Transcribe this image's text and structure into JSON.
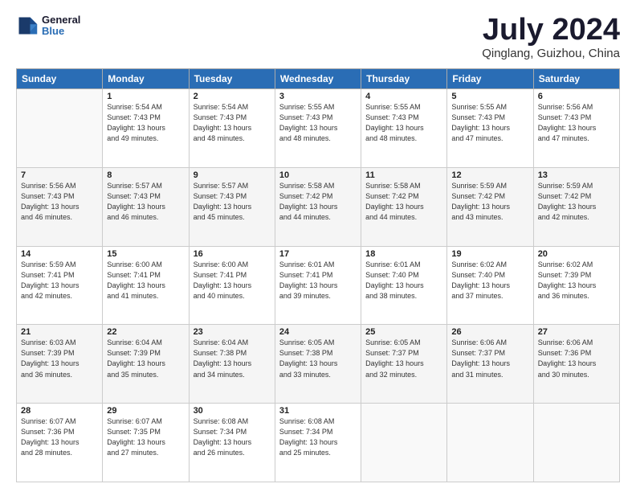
{
  "header": {
    "logo_line1": "General",
    "logo_line2": "Blue",
    "month_title": "July 2024",
    "location": "Qinglang, Guizhou, China"
  },
  "days_of_week": [
    "Sunday",
    "Monday",
    "Tuesday",
    "Wednesday",
    "Thursday",
    "Friday",
    "Saturday"
  ],
  "weeks": [
    [
      {
        "day": "",
        "content": ""
      },
      {
        "day": "1",
        "content": "Sunrise: 5:54 AM\nSunset: 7:43 PM\nDaylight: 13 hours\nand 49 minutes."
      },
      {
        "day": "2",
        "content": "Sunrise: 5:54 AM\nSunset: 7:43 PM\nDaylight: 13 hours\nand 48 minutes."
      },
      {
        "day": "3",
        "content": "Sunrise: 5:55 AM\nSunset: 7:43 PM\nDaylight: 13 hours\nand 48 minutes."
      },
      {
        "day": "4",
        "content": "Sunrise: 5:55 AM\nSunset: 7:43 PM\nDaylight: 13 hours\nand 48 minutes."
      },
      {
        "day": "5",
        "content": "Sunrise: 5:55 AM\nSunset: 7:43 PM\nDaylight: 13 hours\nand 47 minutes."
      },
      {
        "day": "6",
        "content": "Sunrise: 5:56 AM\nSunset: 7:43 PM\nDaylight: 13 hours\nand 47 minutes."
      }
    ],
    [
      {
        "day": "7",
        "content": "Sunrise: 5:56 AM\nSunset: 7:43 PM\nDaylight: 13 hours\nand 46 minutes."
      },
      {
        "day": "8",
        "content": "Sunrise: 5:57 AM\nSunset: 7:43 PM\nDaylight: 13 hours\nand 46 minutes."
      },
      {
        "day": "9",
        "content": "Sunrise: 5:57 AM\nSunset: 7:43 PM\nDaylight: 13 hours\nand 45 minutes."
      },
      {
        "day": "10",
        "content": "Sunrise: 5:58 AM\nSunset: 7:42 PM\nDaylight: 13 hours\nand 44 minutes."
      },
      {
        "day": "11",
        "content": "Sunrise: 5:58 AM\nSunset: 7:42 PM\nDaylight: 13 hours\nand 44 minutes."
      },
      {
        "day": "12",
        "content": "Sunrise: 5:59 AM\nSunset: 7:42 PM\nDaylight: 13 hours\nand 43 minutes."
      },
      {
        "day": "13",
        "content": "Sunrise: 5:59 AM\nSunset: 7:42 PM\nDaylight: 13 hours\nand 42 minutes."
      }
    ],
    [
      {
        "day": "14",
        "content": "Sunrise: 5:59 AM\nSunset: 7:41 PM\nDaylight: 13 hours\nand 42 minutes."
      },
      {
        "day": "15",
        "content": "Sunrise: 6:00 AM\nSunset: 7:41 PM\nDaylight: 13 hours\nand 41 minutes."
      },
      {
        "day": "16",
        "content": "Sunrise: 6:00 AM\nSunset: 7:41 PM\nDaylight: 13 hours\nand 40 minutes."
      },
      {
        "day": "17",
        "content": "Sunrise: 6:01 AM\nSunset: 7:41 PM\nDaylight: 13 hours\nand 39 minutes."
      },
      {
        "day": "18",
        "content": "Sunrise: 6:01 AM\nSunset: 7:40 PM\nDaylight: 13 hours\nand 38 minutes."
      },
      {
        "day": "19",
        "content": "Sunrise: 6:02 AM\nSunset: 7:40 PM\nDaylight: 13 hours\nand 37 minutes."
      },
      {
        "day": "20",
        "content": "Sunrise: 6:02 AM\nSunset: 7:39 PM\nDaylight: 13 hours\nand 36 minutes."
      }
    ],
    [
      {
        "day": "21",
        "content": "Sunrise: 6:03 AM\nSunset: 7:39 PM\nDaylight: 13 hours\nand 36 minutes."
      },
      {
        "day": "22",
        "content": "Sunrise: 6:04 AM\nSunset: 7:39 PM\nDaylight: 13 hours\nand 35 minutes."
      },
      {
        "day": "23",
        "content": "Sunrise: 6:04 AM\nSunset: 7:38 PM\nDaylight: 13 hours\nand 34 minutes."
      },
      {
        "day": "24",
        "content": "Sunrise: 6:05 AM\nSunset: 7:38 PM\nDaylight: 13 hours\nand 33 minutes."
      },
      {
        "day": "25",
        "content": "Sunrise: 6:05 AM\nSunset: 7:37 PM\nDaylight: 13 hours\nand 32 minutes."
      },
      {
        "day": "26",
        "content": "Sunrise: 6:06 AM\nSunset: 7:37 PM\nDaylight: 13 hours\nand 31 minutes."
      },
      {
        "day": "27",
        "content": "Sunrise: 6:06 AM\nSunset: 7:36 PM\nDaylight: 13 hours\nand 30 minutes."
      }
    ],
    [
      {
        "day": "28",
        "content": "Sunrise: 6:07 AM\nSunset: 7:36 PM\nDaylight: 13 hours\nand 28 minutes."
      },
      {
        "day": "29",
        "content": "Sunrise: 6:07 AM\nSunset: 7:35 PM\nDaylight: 13 hours\nand 27 minutes."
      },
      {
        "day": "30",
        "content": "Sunrise: 6:08 AM\nSunset: 7:34 PM\nDaylight: 13 hours\nand 26 minutes."
      },
      {
        "day": "31",
        "content": "Sunrise: 6:08 AM\nSunset: 7:34 PM\nDaylight: 13 hours\nand 25 minutes."
      },
      {
        "day": "",
        "content": ""
      },
      {
        "day": "",
        "content": ""
      },
      {
        "day": "",
        "content": ""
      }
    ]
  ]
}
